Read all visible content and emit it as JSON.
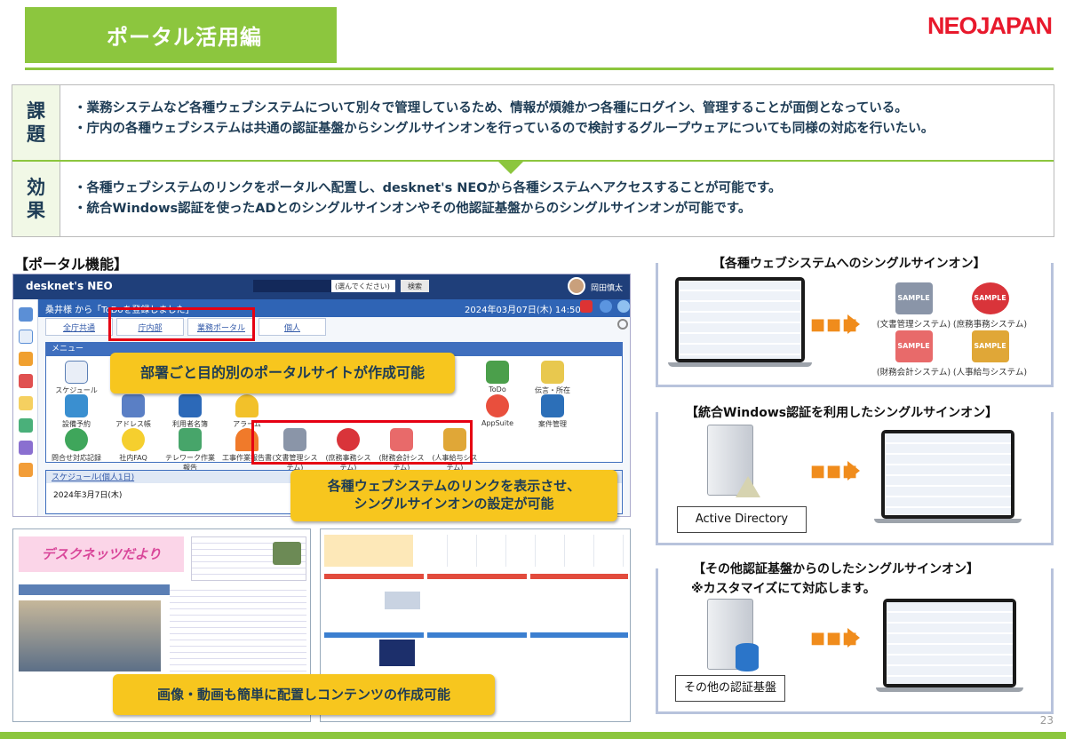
{
  "header": {
    "title": "ポータル活用編",
    "brand_neo": "NEO",
    "brand_japan": "JAPAN"
  },
  "issues": {
    "label_1": "課",
    "label_2": "題",
    "lines": [
      "・業務システムなど各種ウェブシステムについて別々で管理しているため、情報が煩雑かつ各種にログイン、管理することが面倒となっている。",
      "・庁内の各種ウェブシステムは共通の認証基盤からシングルサインオンを行っているので検討するグループウェアについても同様の対応を行いたい。"
    ]
  },
  "effects": {
    "label_1": "効",
    "label_2": "果",
    "lines": [
      "・各種ウェブシステムのリンクをポータルへ配置し、desknet's NEOから各種システムへアクセスすることが可能です。",
      "・統合Windows認証を使ったADとのシングルサインオンやその他認証基盤からのシングルサインオンが可能です。"
    ]
  },
  "portal_section": {
    "label": "【ポータル機能】",
    "app": {
      "logo": "desknet's NEO",
      "select_placeholder": "(選んでください)",
      "search_button": "検索",
      "user_name": "岡田慎太",
      "notice": "桑井様 から「ToDoを登録しました」",
      "datetime": "2024年03月07日(木) 14:50",
      "tabs": [
        "全庁共通",
        "庁内部",
        "業務ポータル",
        "個人"
      ],
      "menu_title": "メニュー",
      "menu_items": [
        "スケジュール",
        "ToDo",
        "伝言・所在",
        "設備予約",
        "アドレス帳",
        "利用者名簿",
        "アラーム",
        "AppSuite",
        "案件管理",
        "問合せ対応記録",
        "社内FAQ",
        "テレワーク作業報告",
        "工事作業報告書",
        "(文書管理システム)",
        "(庶務事務システム)",
        "(財務会計システム)",
        "(人事給与システム)"
      ],
      "sample_label": "SAMPLE",
      "schedule_title": "スケジュール(個人1日)",
      "schedule_date": "2024年3月7日(木)"
    },
    "callout_1": "部署ごと目的別のポータルサイトが作成可能",
    "callout_2_line1": "各種ウェブシステムのリンクを表示させ、",
    "callout_2_line2": "シングルサインオンの設定が可能",
    "thumb_title": "デスクネッツだより",
    "callout_3": "画像・動画も簡単に配置しコンテンツの作成可能"
  },
  "sso_web": {
    "title": "【各種ウェブシステムへのシングルサインオン】",
    "items": [
      "(文書管理システム)",
      "(庶務事務システム)",
      "(財務会計システム)",
      "(人事給与システム)"
    ],
    "sample_label": "SAMPLE"
  },
  "sso_windows": {
    "title": "【統合Windows認証を利用したシングルサインオン】",
    "label": "Active Directory"
  },
  "sso_other": {
    "title": "【その他認証基盤からのしたシングルサインオン】",
    "note": "※カスタマイズにて対応します。",
    "label": "その他の認証基盤"
  },
  "arrow_glyph": "■■■",
  "page_number": "23",
  "colors": {
    "accent_green": "#8cc63e",
    "brand_red": "#e8192c",
    "callout_yellow": "#f7c61e",
    "highlight_red": "#e60012",
    "arrow_orange": "#f08c1c"
  }
}
